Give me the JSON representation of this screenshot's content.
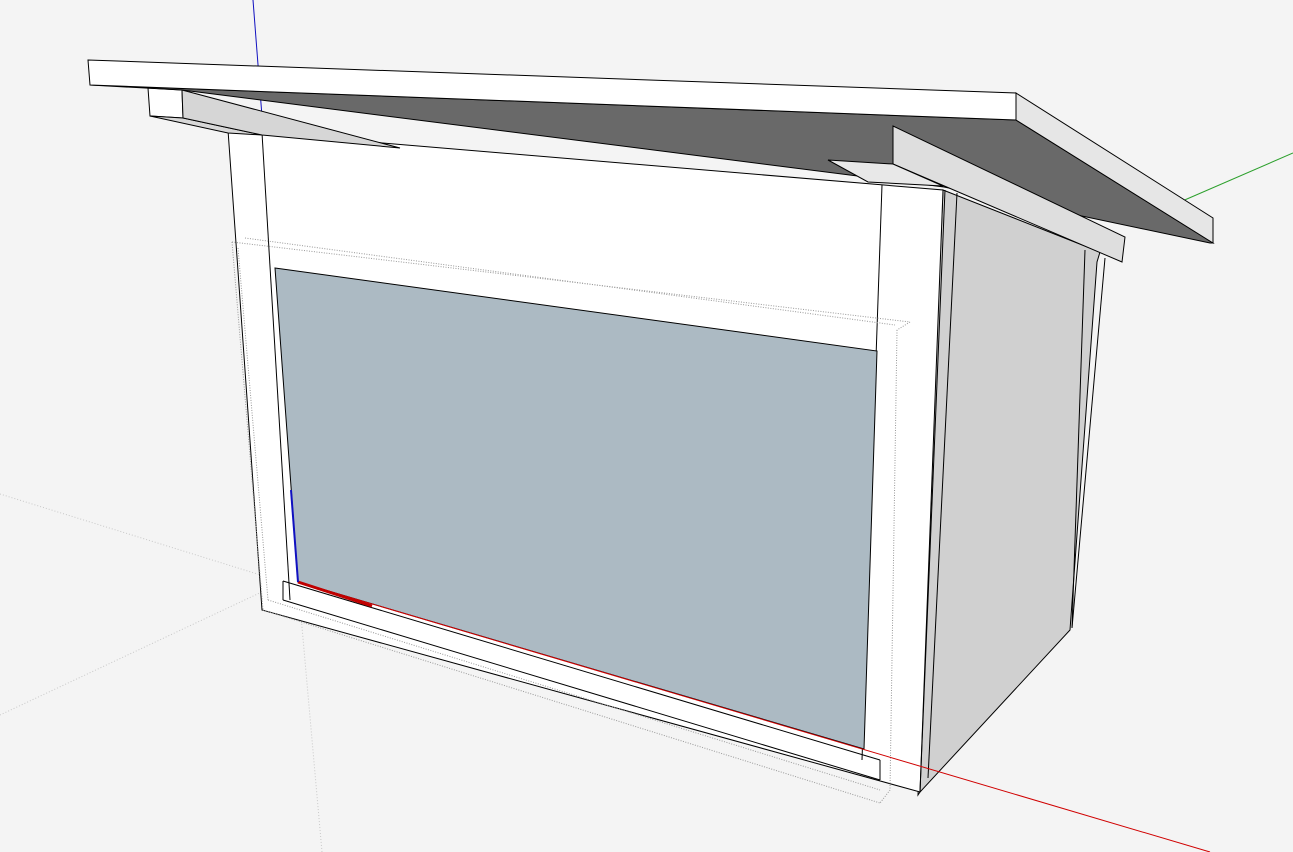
{
  "viewport": {
    "background": "#f4f4f4"
  },
  "colors": {
    "red_axis": "#d00000",
    "green_axis": "#2ca02c",
    "blue_axis": "#1010c0",
    "roof_top": "#ffffff",
    "roof_underside": "#696969",
    "side_wall": "#d0d0d0",
    "panel": "#acbac3",
    "edge": "#000000",
    "guide": "#b0b0b0"
  }
}
